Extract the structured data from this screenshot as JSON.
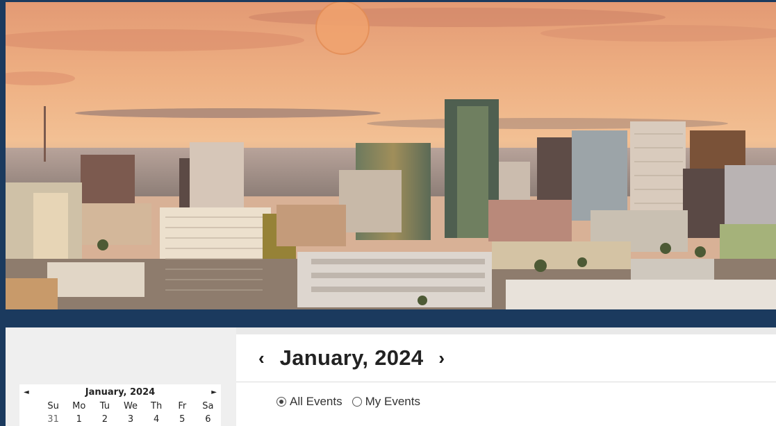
{
  "hero": {
    "alt_name": "city-skyline-banner"
  },
  "mini_calendar": {
    "prev_icon": "◄",
    "next_icon": "►",
    "title": "January, 2024",
    "weekdays": [
      "Su",
      "Mo",
      "Tu",
      "We",
      "Th",
      "Fr",
      "Sa"
    ],
    "first_week": [
      "31",
      "1",
      "2",
      "3",
      "4",
      "5",
      "6"
    ]
  },
  "main_calendar": {
    "prev_icon": "‹",
    "next_icon": "›",
    "title": "January, 2024",
    "filters": {
      "all_events": "All Events",
      "my_events": "My Events",
      "selected": "all_events"
    }
  },
  "colors": {
    "brand_navy": "#1b3a5e",
    "panel_bg": "#efefef",
    "main_bg": "#ffffff"
  }
}
